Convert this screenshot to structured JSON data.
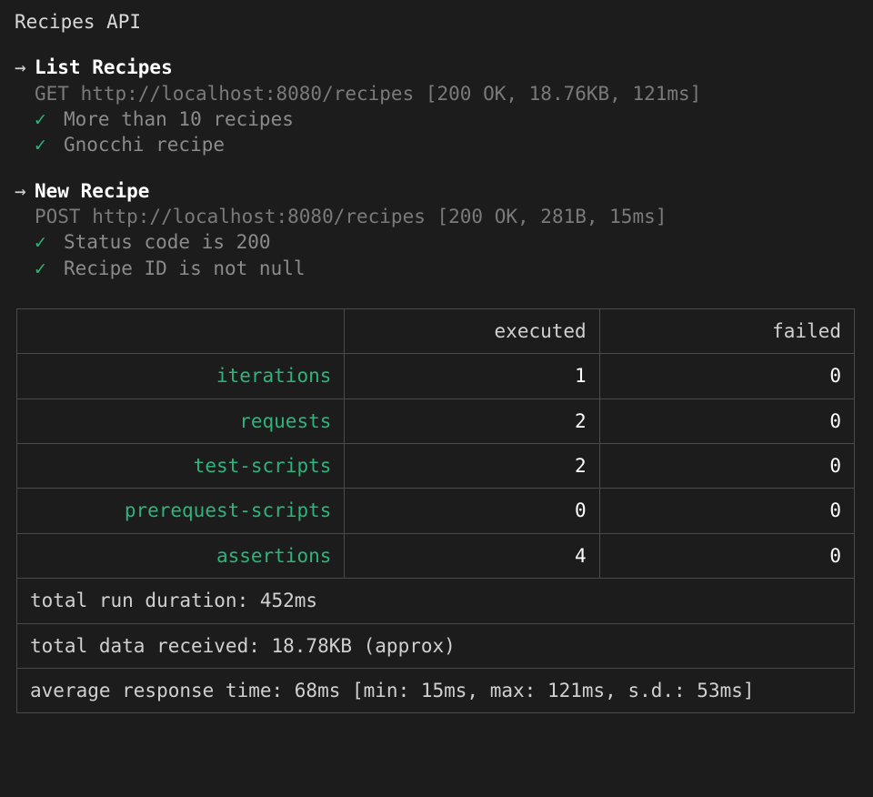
{
  "collection_name": "Recipes API",
  "requests": [
    {
      "name": "List Recipes",
      "line": "GET http://localhost:8080/recipes [200 OK, 18.76KB, 121ms]",
      "assertions": [
        "More than 10 recipes",
        "Gnocchi recipe"
      ]
    },
    {
      "name": "New Recipe",
      "line": "POST http://localhost:8080/recipes [200 OK, 281B, 15ms]",
      "assertions": [
        "Status code is 200",
        "Recipe ID is not null"
      ]
    }
  ],
  "summary": {
    "headers": {
      "executed": "executed",
      "failed": "failed"
    },
    "rows": [
      {
        "label": "iterations",
        "executed": "1",
        "failed": "0"
      },
      {
        "label": "requests",
        "executed": "2",
        "failed": "0"
      },
      {
        "label": "test-scripts",
        "executed": "2",
        "failed": "0"
      },
      {
        "label": "prerequest-scripts",
        "executed": "0",
        "failed": "0"
      },
      {
        "label": "assertions",
        "executed": "4",
        "failed": "0"
      }
    ],
    "footer": [
      "total run duration: 452ms",
      "total data received: 18.78KB (approx)",
      "average response time: 68ms [min: 15ms, max: 121ms, s.d.: 53ms]"
    ]
  }
}
